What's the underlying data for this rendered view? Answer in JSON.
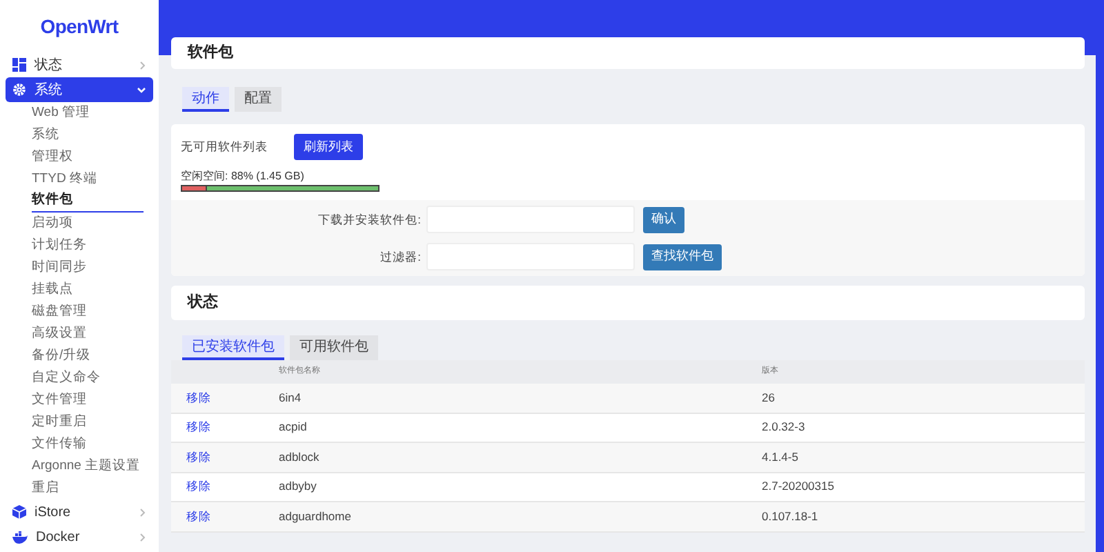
{
  "logo": "OpenWrt",
  "sidebar": {
    "items": [
      {
        "label": "状态",
        "kind": "status",
        "expanded": false,
        "selected": false
      },
      {
        "label": "系统",
        "kind": "system",
        "expanded": true,
        "selected": true,
        "children": [
          {
            "label": "Web 管理",
            "selected": false
          },
          {
            "label": "系统",
            "selected": false
          },
          {
            "label": "管理权",
            "selected": false
          },
          {
            "label": "TTYD 终端",
            "selected": false
          },
          {
            "label": "软件包",
            "selected": true
          },
          {
            "label": "启动项",
            "selected": false
          },
          {
            "label": "计划任务",
            "selected": false
          },
          {
            "label": "时间同步",
            "selected": false
          },
          {
            "label": "挂载点",
            "selected": false
          },
          {
            "label": "磁盘管理",
            "selected": false
          },
          {
            "label": "高级设置",
            "selected": false
          },
          {
            "label": "备份/升级",
            "selected": false
          },
          {
            "label": "自定义命令",
            "selected": false
          },
          {
            "label": "文件管理",
            "selected": false
          },
          {
            "label": "定时重启",
            "selected": false
          },
          {
            "label": "文件传输",
            "selected": false
          },
          {
            "label": "Argonne 主题设置",
            "selected": false
          },
          {
            "label": "重启",
            "selected": false
          }
        ]
      },
      {
        "label": "iStore",
        "kind": "store",
        "expanded": false,
        "selected": false
      },
      {
        "label": "Docker",
        "kind": "docker",
        "expanded": false,
        "selected": false
      }
    ]
  },
  "page_title": "软件包",
  "tabs": [
    {
      "label": "动作",
      "selected": true
    },
    {
      "label": "配置",
      "selected": false
    }
  ],
  "actions": {
    "no_list_text": "无可用软件列表",
    "refresh_button": "刷新列表",
    "free_space": "空闲空间: 88% (1.45 GB)",
    "level": 0.88,
    "install_label": "下载并安装软件包:",
    "confirm_button": "确认",
    "filter_label": "过滤器:",
    "find_button": "查找软件包"
  },
  "status_title": "状态",
  "status_tabs": [
    {
      "label": "已安装软件包",
      "selected": true
    },
    {
      "label": "可用软件包",
      "selected": false
    }
  ],
  "table": {
    "columns": [
      "软件包名称",
      "版本"
    ],
    "rows": [
      {
        "action": "移除",
        "name": "6in4",
        "version": "26"
      },
      {
        "action": "移除",
        "name": "acpid",
        "version": "2.0.32-3"
      },
      {
        "action": "移除",
        "name": "adblock",
        "version": "4.1.4-5"
      },
      {
        "action": "移除",
        "name": "adbyby",
        "version": "2.7-20200315"
      },
      {
        "action": "移除",
        "name": "adguardhome",
        "version": "0.107.18-1"
      }
    ]
  }
}
